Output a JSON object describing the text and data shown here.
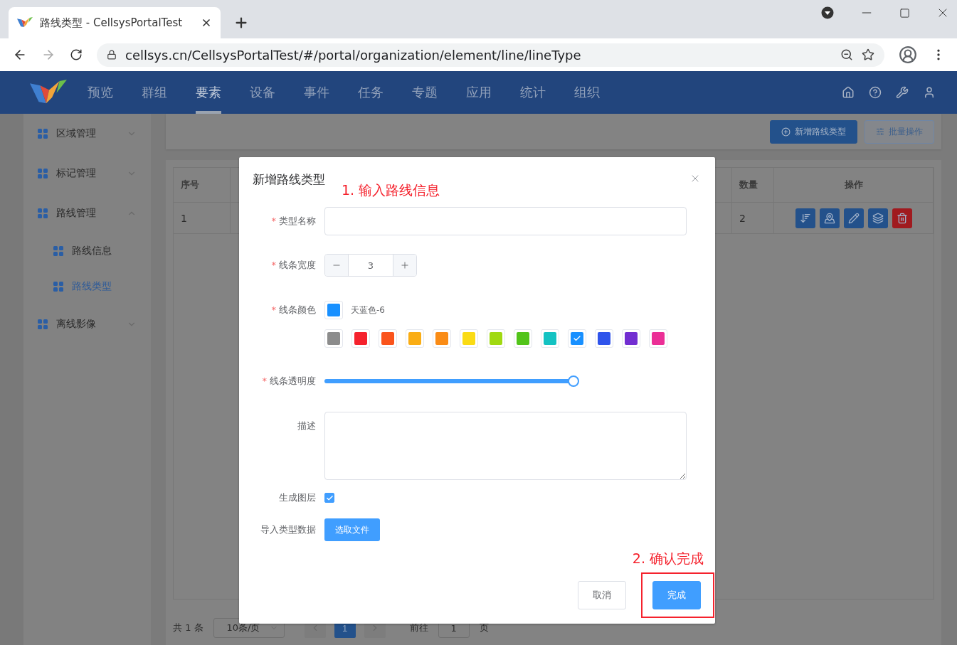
{
  "browser": {
    "tab_title": "路线类型 - CellsysPortalTest",
    "url": "cellsys.cn/CellsysPortalTest/#/portal/organization/element/line/lineType"
  },
  "app_header": {
    "nav": [
      {
        "label": "预览",
        "selected": false
      },
      {
        "label": "群组",
        "selected": false
      },
      {
        "label": "要素",
        "selected": true
      },
      {
        "label": "设备",
        "selected": false
      },
      {
        "label": "事件",
        "selected": false
      },
      {
        "label": "任务",
        "selected": false
      },
      {
        "label": "专题",
        "selected": false
      },
      {
        "label": "应用",
        "selected": false
      },
      {
        "label": "统计",
        "selected": false
      },
      {
        "label": "组织",
        "selected": false
      }
    ]
  },
  "sidebar": {
    "items": [
      {
        "label": "区域管理",
        "expanded": false
      },
      {
        "label": "标记管理",
        "expanded": false
      },
      {
        "label": "路线管理",
        "expanded": true,
        "children": [
          {
            "label": "路线信息",
            "selected": false
          },
          {
            "label": "路线类型",
            "selected": true
          }
        ]
      },
      {
        "label": "离线影像",
        "expanded": false
      }
    ]
  },
  "toolbar": {
    "buttons": [
      {
        "label": "新增路线类型",
        "kind": "primary"
      },
      {
        "label": "批量操作",
        "kind": "secondary"
      }
    ]
  },
  "table": {
    "columns": [
      "序号",
      "数量",
      "操作"
    ],
    "rows": [
      {
        "cells": [
          "1",
          "2"
        ],
        "actions": [
          {
            "kind": "sort"
          },
          {
            "kind": "map"
          },
          {
            "kind": "edit"
          },
          {
            "kind": "layers"
          },
          {
            "kind": "delete"
          }
        ]
      }
    ]
  },
  "pagination": {
    "total": "共 1 条",
    "page_size": "10条/页",
    "pages": [
      {
        "label": "1",
        "selected": true
      }
    ],
    "goto_label": "前往",
    "goto_value": "1",
    "goto_suffix": "页"
  },
  "modal": {
    "title": "新增路线类型",
    "title_note": "1. 输入路线信息",
    "fields": [
      {
        "kind": "text",
        "label": "类型名称",
        "required_mark": "*"
      },
      {
        "kind": "stepper",
        "label": "线条宽度",
        "required_mark": "*",
        "value": "3"
      },
      {
        "kind": "color",
        "label": "线条颜色",
        "required_mark": "*",
        "color_name": "天蓝色-6",
        "swatches": [
          {
            "color": "#8c8c8c",
            "selected": false
          },
          {
            "color": "#f5222d",
            "selected": false
          },
          {
            "color": "#fa541c",
            "selected": false
          },
          {
            "color": "#faad14",
            "selected": false
          },
          {
            "color": "#fa8c16",
            "selected": false
          },
          {
            "color": "#fadb14",
            "selected": false
          },
          {
            "color": "#a0d911",
            "selected": false
          },
          {
            "color": "#52c41a",
            "selected": false
          },
          {
            "color": "#13c2c2",
            "selected": false
          },
          {
            "color": "#1890ff",
            "selected": true
          },
          {
            "color": "#2f54eb",
            "selected": false
          },
          {
            "color": "#722ed1",
            "selected": false
          },
          {
            "color": "#eb2f96",
            "selected": false
          }
        ]
      },
      {
        "kind": "slider",
        "label": "线条透明度",
        "required_mark": "*",
        "level": 1
      },
      {
        "kind": "textarea",
        "label": "描述"
      },
      {
        "kind": "checkbox",
        "label": "生成图层",
        "checked": true
      },
      {
        "kind": "file",
        "label": "导入类型数据",
        "button": "选取文件"
      }
    ],
    "footer_note": "2. 确认完成",
    "buttons": [
      {
        "label": "取消",
        "kind": "default",
        "highlighted": false
      },
      {
        "label": "完成",
        "kind": "primary",
        "highlighted": true
      }
    ]
  }
}
